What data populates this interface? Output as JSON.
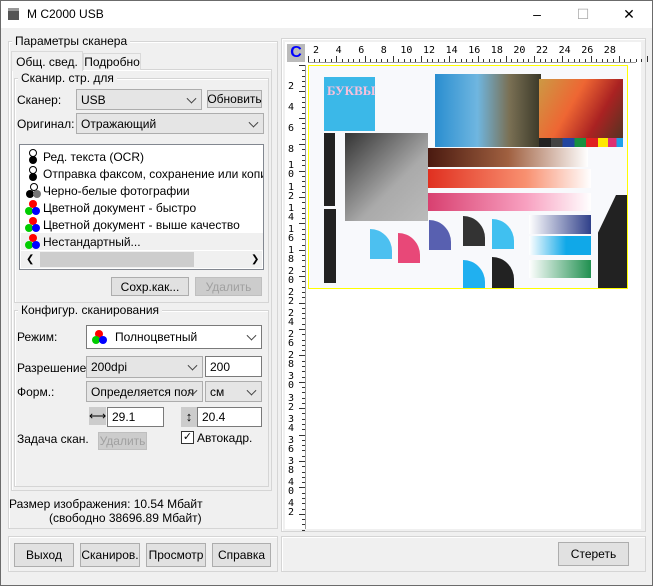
{
  "window": {
    "title": "M C2000 USB",
    "minimize": "–",
    "maximize": "☐",
    "close": "✕"
  },
  "scanner_params": {
    "legend": "Параметры сканера",
    "tabs": [
      {
        "label": "Общ. свед.",
        "selected": true
      },
      {
        "label": "Подробно",
        "selected": false
      }
    ],
    "scan_for": {
      "legend": "Сканир. стр. для",
      "scanner_label": "Сканер:",
      "scanner_value": "USB",
      "refresh_button": "Обновить",
      "original_label": "Оригинал:",
      "original_value": "Отражающий",
      "presets": [
        {
          "label": "Ред. текста (OCR)",
          "icon": "bw-icon"
        },
        {
          "label": "Отправка факсом, сохранение или копиров",
          "icon": "bw-icon"
        },
        {
          "label": "Черно-белые фотографии",
          "icon": "grayscale-icon"
        },
        {
          "label": "Цветной документ - быстро",
          "icon": "color-icon"
        },
        {
          "label": "Цветной документ - выше качество",
          "icon": "color-icon"
        },
        {
          "label": "Нестандартный...",
          "icon": "color-icon",
          "selected": true
        }
      ],
      "save_as_button": "Сохр.как...",
      "delete_button": "Удалить"
    },
    "config": {
      "legend": "Конфигур. сканирования",
      "mode_label": "Режим:",
      "mode_value": "Полноцветный",
      "resolution_label": "Разрешение:",
      "resolution_value": "200dpi",
      "resolution_input": "200",
      "format_label": "Форм.:",
      "format_value": "Определяется пол",
      "unit_value": "см",
      "width_value": "29.1",
      "height_value": "20.4",
      "task_label": "Задача скан.",
      "task_delete_button": "Удалить",
      "autocrop_label": "Автокадр.",
      "autocrop_checked": true
    }
  },
  "image_size": {
    "line1": "Размер изображения: 10.54 Мбайт",
    "line2": "(свободно 38696.89 Мбайт)"
  },
  "buttons": {
    "exit": "Выход",
    "scan": "Сканиров.",
    "preview": "Просмотр",
    "help": "Справка",
    "clear": "Стереть"
  },
  "preview": {
    "unit_icon": "C",
    "top_ruler": [
      "2",
      "4",
      "6",
      "8",
      "10",
      "12",
      "14",
      "16",
      "18",
      "20",
      "22",
      "24",
      "26",
      "28"
    ],
    "left_ruler": [
      "2",
      "4",
      "6",
      "8",
      "10",
      "12",
      "14",
      "16",
      "18",
      "20",
      "22",
      "24",
      "26",
      "28",
      "30",
      "32",
      "34",
      "36",
      "38",
      "40",
      "42"
    ],
    "sample_text": "БУКВЫ",
    "sample_text_small": "БУКВЫ"
  },
  "colors": {
    "accent": "#0078d7",
    "scan_frame": "#0000ff",
    "scan_frame_alt": "#ffff00"
  }
}
